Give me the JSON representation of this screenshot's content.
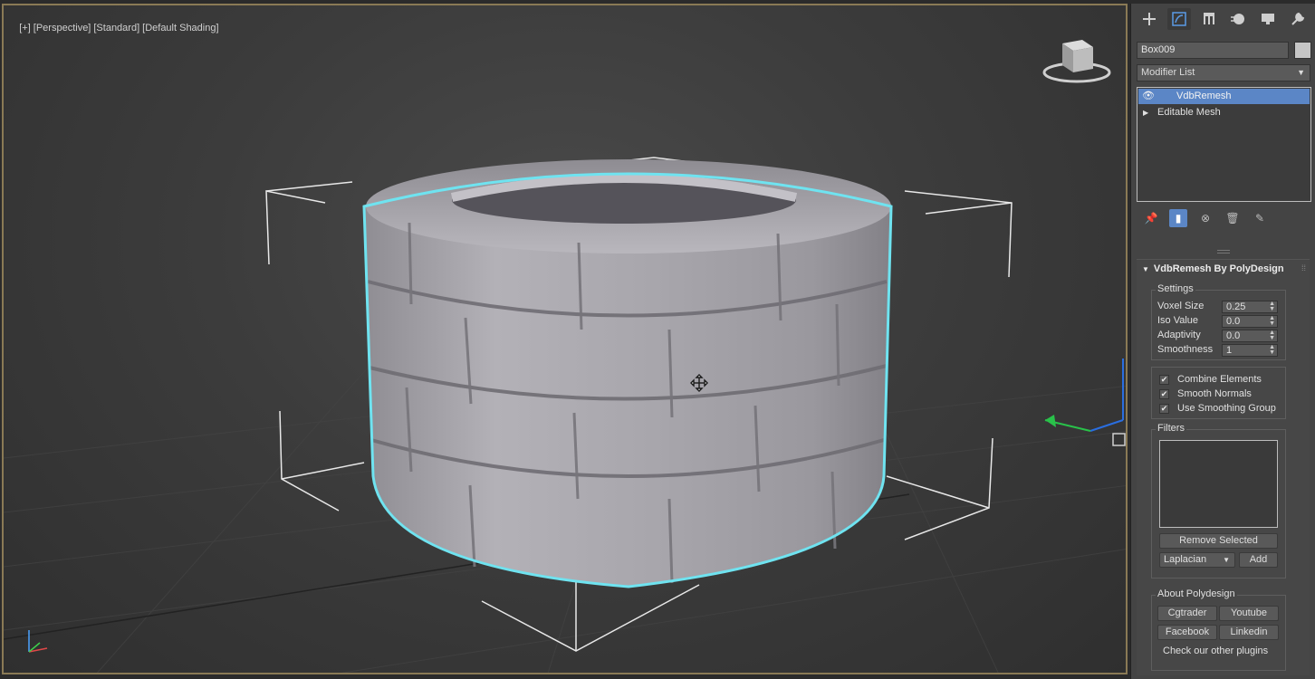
{
  "viewport": {
    "labels": [
      "[+]",
      "[Perspective]",
      "[Standard]",
      "[Default Shading]"
    ]
  },
  "panel": {
    "tabs": [
      {
        "name": "create-tab-icon"
      },
      {
        "name": "modify-tab-icon"
      },
      {
        "name": "hierarchy-tab-icon"
      },
      {
        "name": "motion-tab-icon"
      },
      {
        "name": "display-tab-icon"
      },
      {
        "name": "utilities-tab-icon"
      }
    ],
    "object_name": "Box009",
    "object_color": "#c6c6c6",
    "modifier_list": "Modifier List",
    "stack": [
      {
        "label": "VdbRemesh",
        "selected": true
      },
      {
        "label": "Editable Mesh",
        "selected": false
      }
    ],
    "rollout": {
      "title": "VdbRemesh By PolyDesign",
      "settings": {
        "title": "Settings",
        "voxel_size_label": "Voxel Size",
        "voxel_size": "0.25",
        "iso_value_label": "Iso Value",
        "iso_value": "0.0",
        "adaptivity_label": "Adaptivity",
        "adaptivity": "0.0",
        "smoothness_label": "Smoothness",
        "smoothness": "1"
      },
      "options": {
        "combine_elements": "Combine Elements",
        "smooth_normals": "Smooth Normals",
        "use_smoothing_group": "Use Smoothing Group"
      },
      "filters": {
        "title": "Filters",
        "remove_selected": "Remove Selected",
        "filter_type": "Laplacian",
        "add": "Add"
      },
      "about": {
        "title": "About Polydesign",
        "cgtrader": "Cgtrader",
        "youtube": "Youtube",
        "facebook": "Facebook",
        "linkedin": "Linkedin",
        "other_plugins": "Check our other plugins"
      }
    }
  },
  "colors": {
    "selection_outline": "#6fe3f0",
    "accent": "#5b86c6",
    "stone": "#a9a7ad"
  }
}
